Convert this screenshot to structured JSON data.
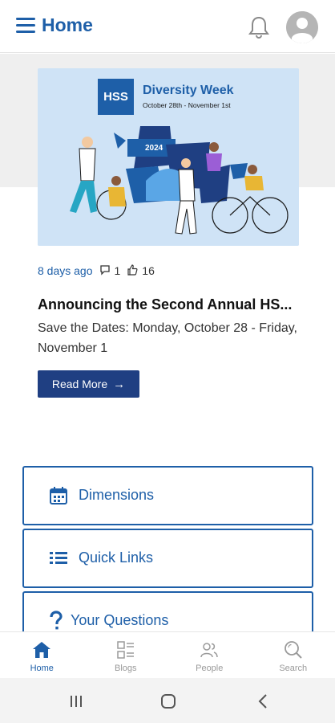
{
  "header": {
    "title": "Home",
    "menu_icon": "hamburger-menu-icon",
    "notification_icon": "bell-icon",
    "avatar_icon": "user-avatar-icon"
  },
  "banner": {
    "logo_text": "HSS",
    "title": "Diversity Week",
    "dates": "October 28th - November 1st",
    "year_label": "2024"
  },
  "post": {
    "time_ago": "8 days ago",
    "comment_count": "1",
    "like_count": "16",
    "title": "Announcing the Second Annual HS...",
    "description": "Save the Dates: Monday, October 28 - Friday, November 1",
    "read_more_label": "Read More"
  },
  "tiles": [
    {
      "label": "Dimensions",
      "icon": "calendar-icon"
    },
    {
      "label": "Quick Links",
      "icon": "list-icon"
    },
    {
      "label": "Your Questions",
      "icon": "question-icon"
    }
  ],
  "bottom_nav": [
    {
      "label": "Home",
      "icon": "home-icon",
      "active": true
    },
    {
      "label": "Blogs",
      "icon": "blogs-icon",
      "active": false
    },
    {
      "label": "People",
      "icon": "people-icon",
      "active": false
    },
    {
      "label": "Search",
      "icon": "search-icon",
      "active": false
    }
  ],
  "colors": {
    "brand_blue": "#1e5fa8",
    "button_navy": "#1f3f82",
    "banner_bg": "#cfe3f6"
  }
}
